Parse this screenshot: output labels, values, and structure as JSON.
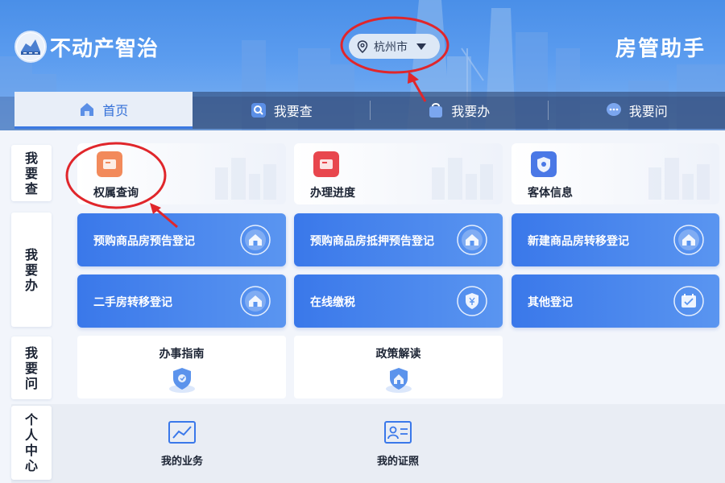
{
  "header": {
    "app_title": "不动产智治",
    "right_title": "房管助手",
    "city": "杭州市"
  },
  "tabs": [
    {
      "label": "首页",
      "icon": "home-icon",
      "active": true
    },
    {
      "label": "我要查",
      "icon": "search-doc-icon",
      "active": false
    },
    {
      "label": "我要办",
      "icon": "bag-icon",
      "active": false
    },
    {
      "label": "我要问",
      "icon": "chat-icon",
      "active": false
    }
  ],
  "sections": {
    "query": "我要查",
    "handle": "我要办",
    "ask": "我要问",
    "personal": "个人中心"
  },
  "query_cards": [
    {
      "label": "权属查询",
      "icon": "ownership-query-icon",
      "color": "#f07a4a"
    },
    {
      "label": "办理进度",
      "icon": "progress-icon",
      "color": "#e8464d"
    },
    {
      "label": "客体信息",
      "icon": "object-info-icon",
      "color": "#4a78e6"
    }
  ],
  "handle_cards": [
    {
      "label": "预购商品房预告登记",
      "icon": "house-icon"
    },
    {
      "label": "预购商品房抵押预告登记",
      "icon": "house-icon"
    },
    {
      "label": "新建商品房转移登记",
      "icon": "house-icon"
    },
    {
      "label": "二手房转移登记",
      "icon": "house-icon"
    },
    {
      "label": "在线缴税",
      "icon": "tax-shield-icon"
    },
    {
      "label": "其他登记",
      "icon": "calendar-check-icon"
    }
  ],
  "ask_cards": [
    {
      "label": "办事指南",
      "icon": "guide-shield-icon"
    },
    {
      "label": "政策解读",
      "icon": "policy-house-icon"
    }
  ],
  "personal_items": [
    {
      "label": "我的业务",
      "icon": "chart-icon"
    },
    {
      "label": "我的证照",
      "icon": "id-card-icon"
    }
  ],
  "colors": {
    "primary": "#3a78ea",
    "annotation": "#e0262b"
  }
}
